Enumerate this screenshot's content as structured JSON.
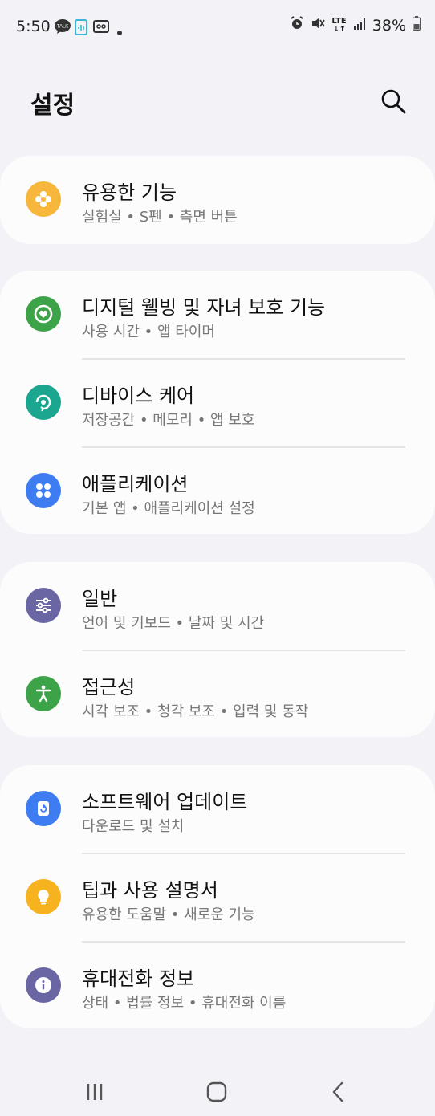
{
  "status": {
    "time": "5:50",
    "battery": "38%",
    "network": "LTE"
  },
  "header": {
    "title": "설정"
  },
  "cards": [
    {
      "items": [
        {
          "icon": "puzzle-icon",
          "title": "유용한 기능",
          "subtitle": "실험실 • S펜 • 측면 버튼"
        }
      ]
    },
    {
      "items": [
        {
          "icon": "wellbeing-icon",
          "title": "디지털 웰빙 및 자녀 보호 기능",
          "subtitle": "사용 시간 • 앱 타이머"
        },
        {
          "icon": "device-care-icon",
          "title": "디바이스 케어",
          "subtitle": "저장공간 • 메모리 • 앱 보호"
        },
        {
          "icon": "apps-grid-icon",
          "title": "애플리케이션",
          "subtitle": "기본 앱 • 애플리케이션 설정"
        }
      ]
    },
    {
      "items": [
        {
          "icon": "sliders-icon",
          "title": "일반",
          "subtitle": "언어 및 키보드 • 날짜 및 시간"
        },
        {
          "icon": "accessibility-icon",
          "title": "접근성",
          "subtitle": "시각 보조 • 청각 보조 • 입력 및 동작"
        }
      ]
    },
    {
      "items": [
        {
          "icon": "software-update-icon",
          "title": "소프트웨어 업데이트",
          "subtitle": "다운로드 및 설치"
        },
        {
          "icon": "lightbulb-icon",
          "title": "팁과 사용 설명서",
          "subtitle": "유용한 도움말 • 새로운 기능"
        },
        {
          "icon": "info-icon",
          "title": "휴대전화 정보",
          "subtitle": "상태 • 법률 정보 • 휴대전화 이름"
        }
      ]
    }
  ],
  "colors": {
    "useful": "#f6b73c",
    "wellbeing": "#3ca348",
    "device_care": "#1aa68f",
    "apps": "#3e7cf2",
    "general": "#6a66a3",
    "accessibility": "#3ca348",
    "update": "#3e7cf2",
    "tips": "#f6b21f",
    "info": "#6a66a3"
  }
}
